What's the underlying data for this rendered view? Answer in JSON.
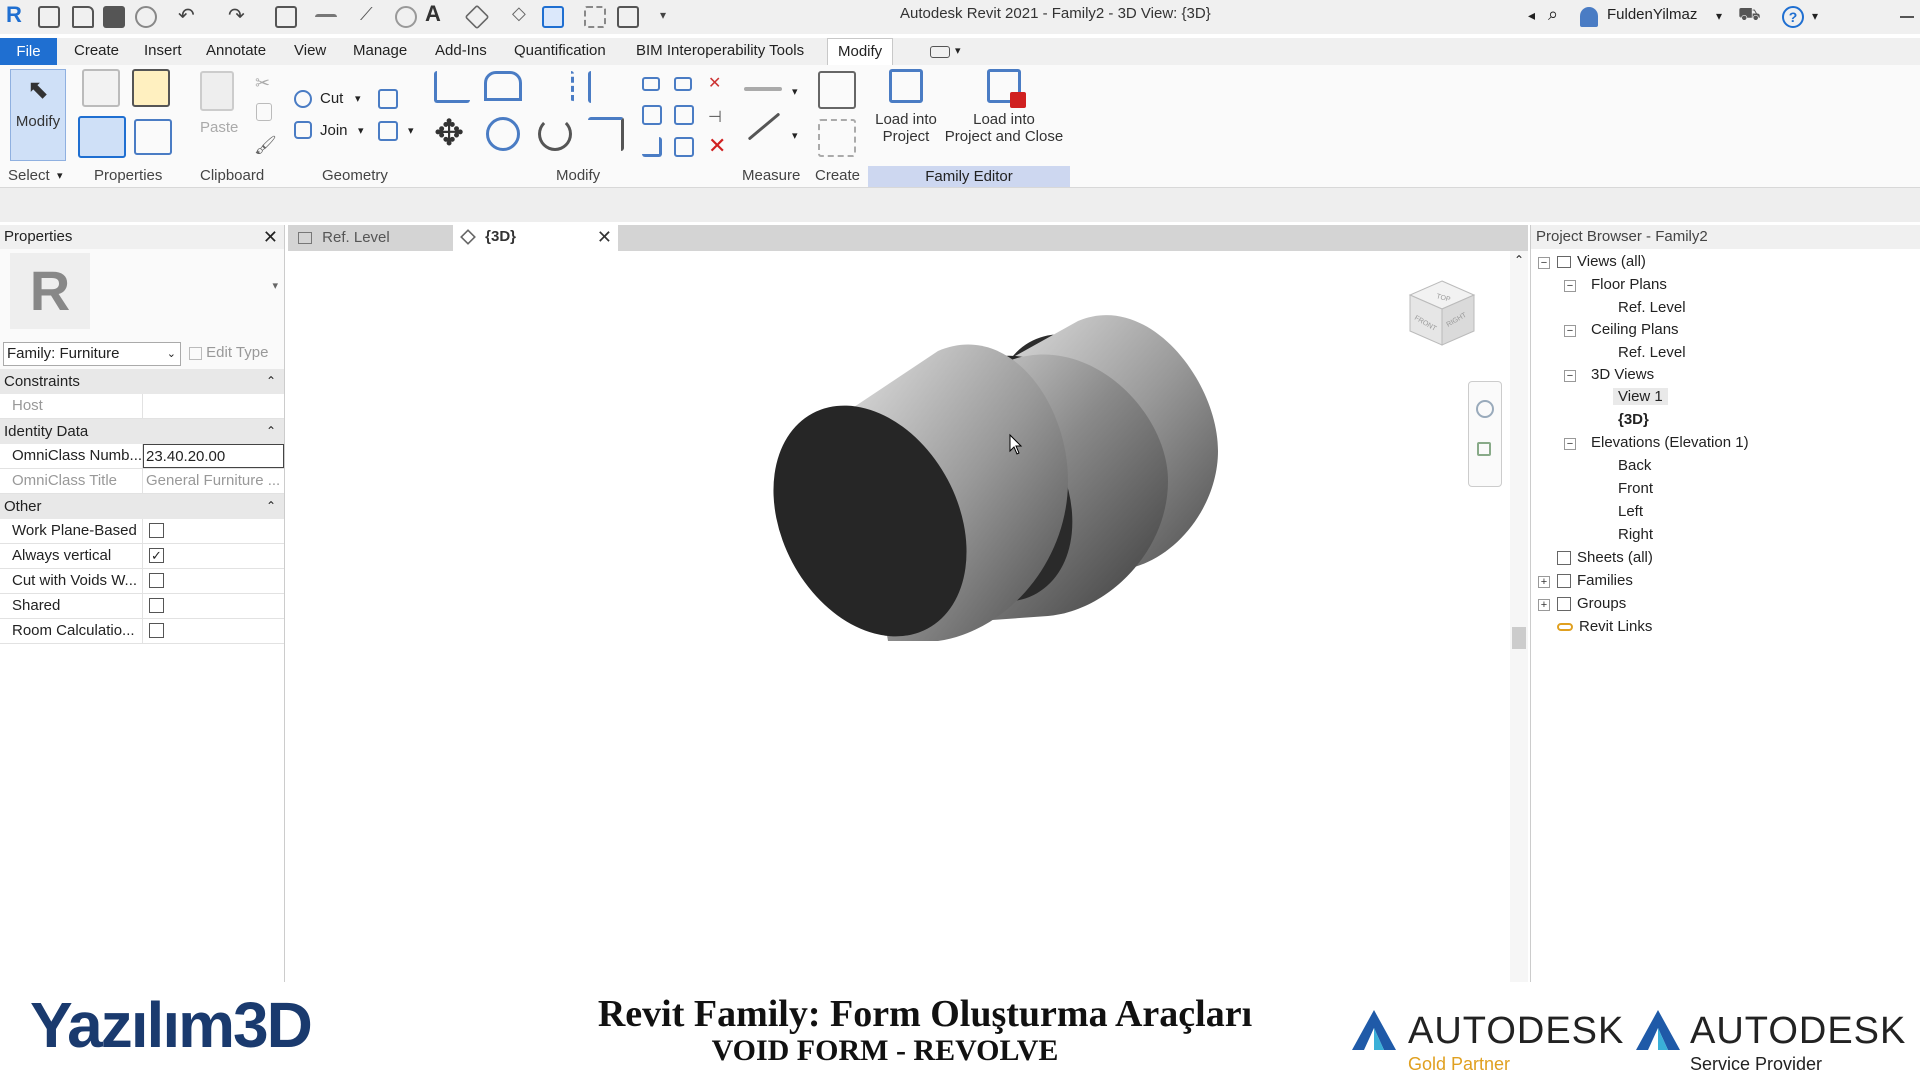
{
  "app": {
    "title": "Autodesk Revit 2021 - Family2 - 3D View: {3D}",
    "user": "FuldenYilmaz"
  },
  "menu": {
    "tabs": [
      "File",
      "Create",
      "Insert",
      "Annotate",
      "View",
      "Manage",
      "Add-Ins",
      "Quantification",
      "BIM Interoperability Tools",
      "Modify"
    ]
  },
  "ribbon": {
    "modify_label": "Modify",
    "cut_label": "Cut",
    "join_label": "Join",
    "paste_label": "Paste",
    "load_into_project": [
      "Load into",
      "Project"
    ],
    "load_into_project_close": [
      "Load into",
      "Project and Close"
    ],
    "panels": [
      "Select",
      "Properties",
      "Clipboard",
      "Geometry",
      "Modify",
      "Measure",
      "Create",
      "Family Editor"
    ]
  },
  "properties": {
    "title": "Properties",
    "family_selector": "Family: Furniture",
    "edit_type": "Edit Type",
    "sections": {
      "constraints": "Constraints",
      "identity": "Identity Data",
      "other": "Other"
    },
    "host": "Host",
    "omniclass_number_label": "OmniClass Numb...",
    "omniclass_number_value": "23.40.20.00",
    "omniclass_title_label": "OmniClass Title",
    "omniclass_title_value": "General Furniture ...",
    "checks": [
      {
        "label": "Work Plane-Based",
        "checked": false
      },
      {
        "label": "Always vertical",
        "checked": true
      },
      {
        "label": "Cut with Voids W...",
        "checked": false
      },
      {
        "label": "Shared",
        "checked": false
      },
      {
        "label": "Room Calculatio...",
        "checked": false
      }
    ]
  },
  "view_tabs": [
    {
      "label": "Ref. Level",
      "active": false
    },
    {
      "label": "{3D}",
      "active": true
    }
  ],
  "viewcube": {
    "top": "TOP",
    "front": "FRONT",
    "right": "RIGHT"
  },
  "browser": {
    "title": "Project Browser - Family2",
    "nodes": {
      "views_all": "Views (all)",
      "floor_plans": "Floor Plans",
      "fp_ref": "Ref. Level",
      "ceiling_plans": "Ceiling Plans",
      "cp_ref": "Ref. Level",
      "views_3d": "3D Views",
      "view1": "View 1",
      "v3d": "{3D}",
      "elevations": "Elevations (Elevation 1)",
      "back": "Back",
      "front": "Front",
      "left": "Left",
      "right": "Right",
      "sheets": "Sheets (all)",
      "families": "Families",
      "groups": "Groups",
      "links": "Revit Links"
    }
  },
  "footer": {
    "logo": "Yazılım3D",
    "title": "Revit Family: Form Oluşturma Araçları",
    "subtitle": "VOID FORM - REVOLVE",
    "partner1_name": "AUTODESK",
    "partner1_sub": "Gold Partner",
    "partner2_name": "AUTODESK",
    "partner2_sub": "Service Provider"
  },
  "colors": {
    "accent": "#1f6fd1",
    "family_editor_bg": "#cdd7f0",
    "gold": "#e0a020"
  }
}
